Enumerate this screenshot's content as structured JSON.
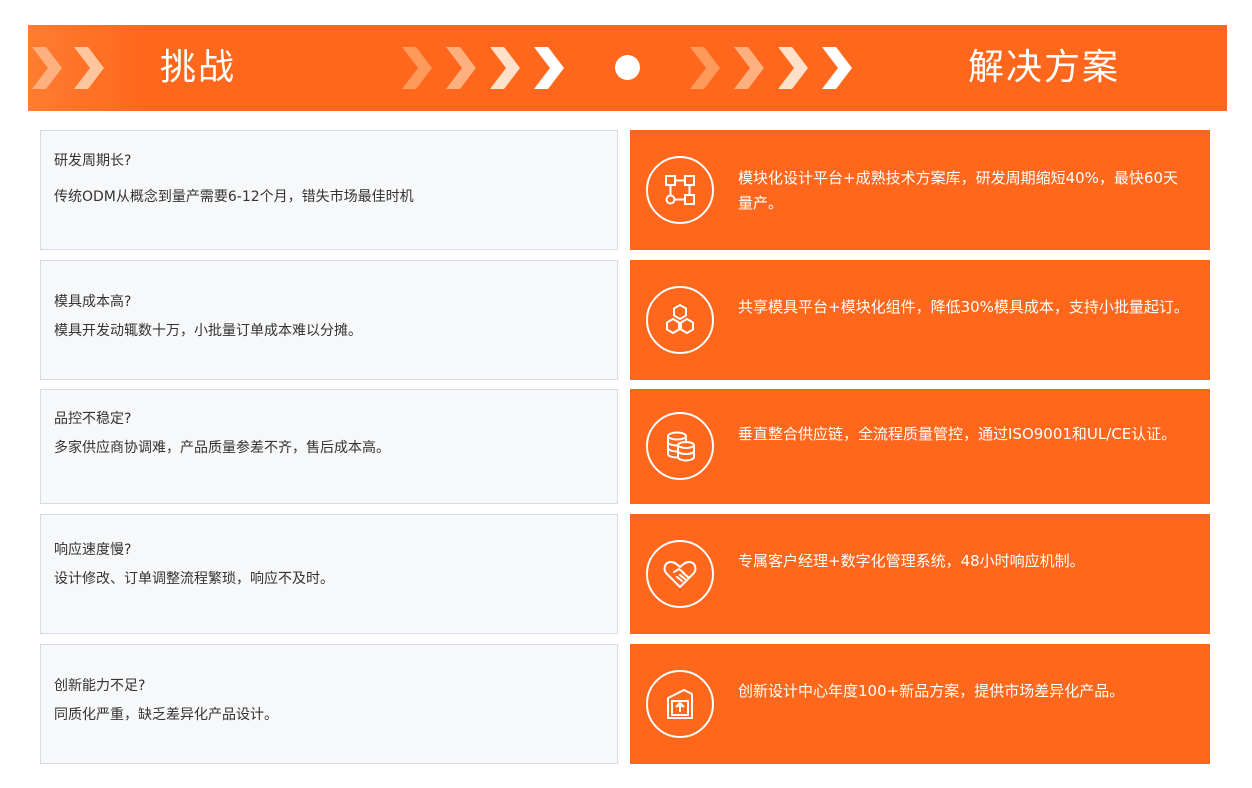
{
  "header": {
    "left_title": "挑战",
    "right_title": "解决方案"
  },
  "rows": [
    {
      "challenge_title": "研发周期长?",
      "challenge_desc": "传统ODM从概念到量产需要6-12个月，错失市场最佳时机",
      "solution_icon": "flowchart-icon",
      "solution_text": "模块化设计平台+成熟技术方案库，研发周期缩短40%，最快60天量产。"
    },
    {
      "challenge_title": "模具成本高?",
      "challenge_desc": "模具开发动辄数十万，小批量订单成本难以分摊。",
      "solution_icon": "hexagons-icon",
      "solution_text": "共享模具平台+模块化组件，降低30%模具成本，支持小批量起订。"
    },
    {
      "challenge_title": "品控不稳定?",
      "challenge_desc": "多家供应商协调难，产品质量参差不齐，售后成本高。",
      "solution_icon": "database-icon",
      "solution_text": "垂直整合供应链，全流程质量管控，通过ISO9001和UL/CE认证。"
    },
    {
      "challenge_title": "响应速度慢?",
      "challenge_desc": "设计修改、订单调整流程繁琐，响应不及时。",
      "solution_icon": "heart-handshake-icon",
      "solution_text": "专属客户经理+数字化管理系统，48小时响应机制。"
    },
    {
      "challenge_title": "创新能力不足?",
      "challenge_desc": "同质化严重，缺乏差异化产品设计。",
      "solution_icon": "upload-box-icon",
      "solution_text": "创新设计中心年度100+新品方案，提供市场差异化产品。"
    }
  ],
  "colors": {
    "accent": "#ff671c",
    "challenge_bg": "#f7f8fa",
    "challenge_border": "#d7dbe6"
  }
}
